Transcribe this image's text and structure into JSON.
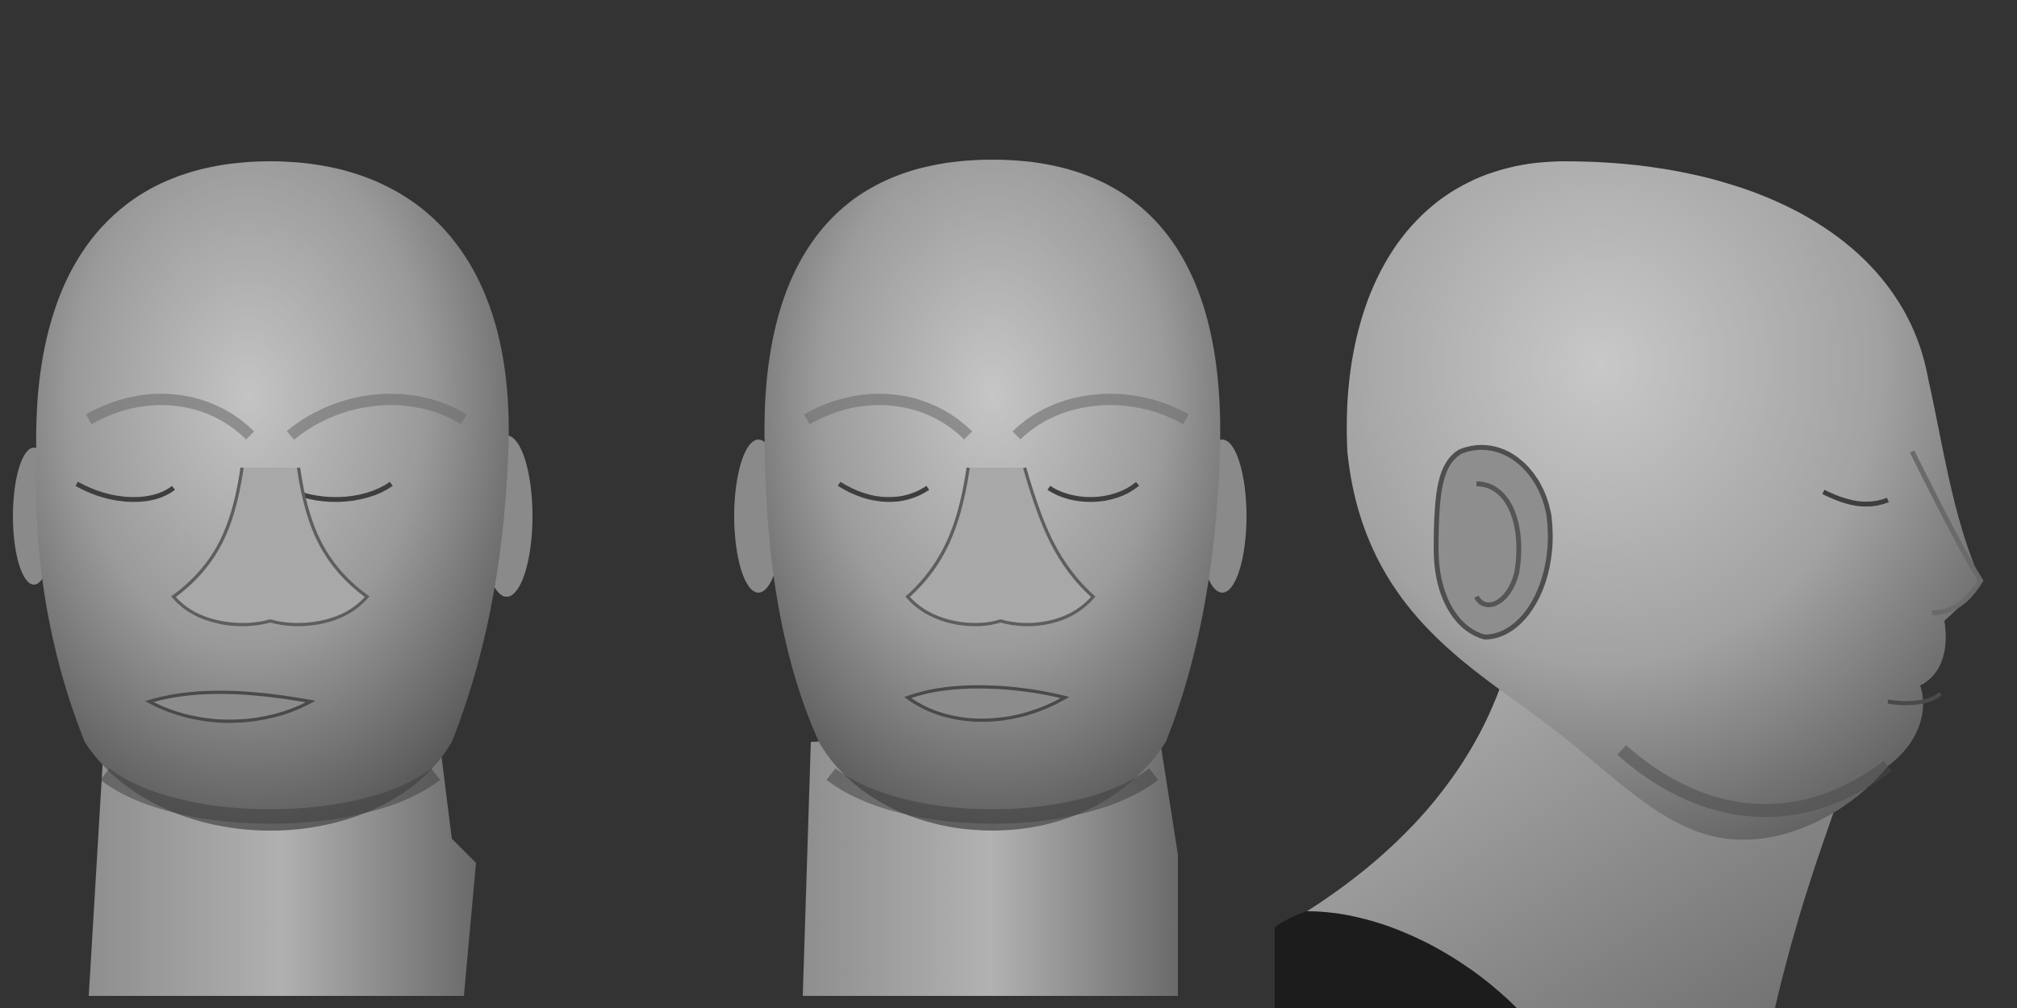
{
  "scene": {
    "background_color": "#333333",
    "material_color": "#9a9a9a",
    "views": [
      {
        "id": "front-1",
        "kind": "front-head-sculpt"
      },
      {
        "id": "front-2",
        "kind": "front-head-sculpt"
      },
      {
        "id": "profile",
        "kind": "side-head-sculpt"
      }
    ]
  }
}
